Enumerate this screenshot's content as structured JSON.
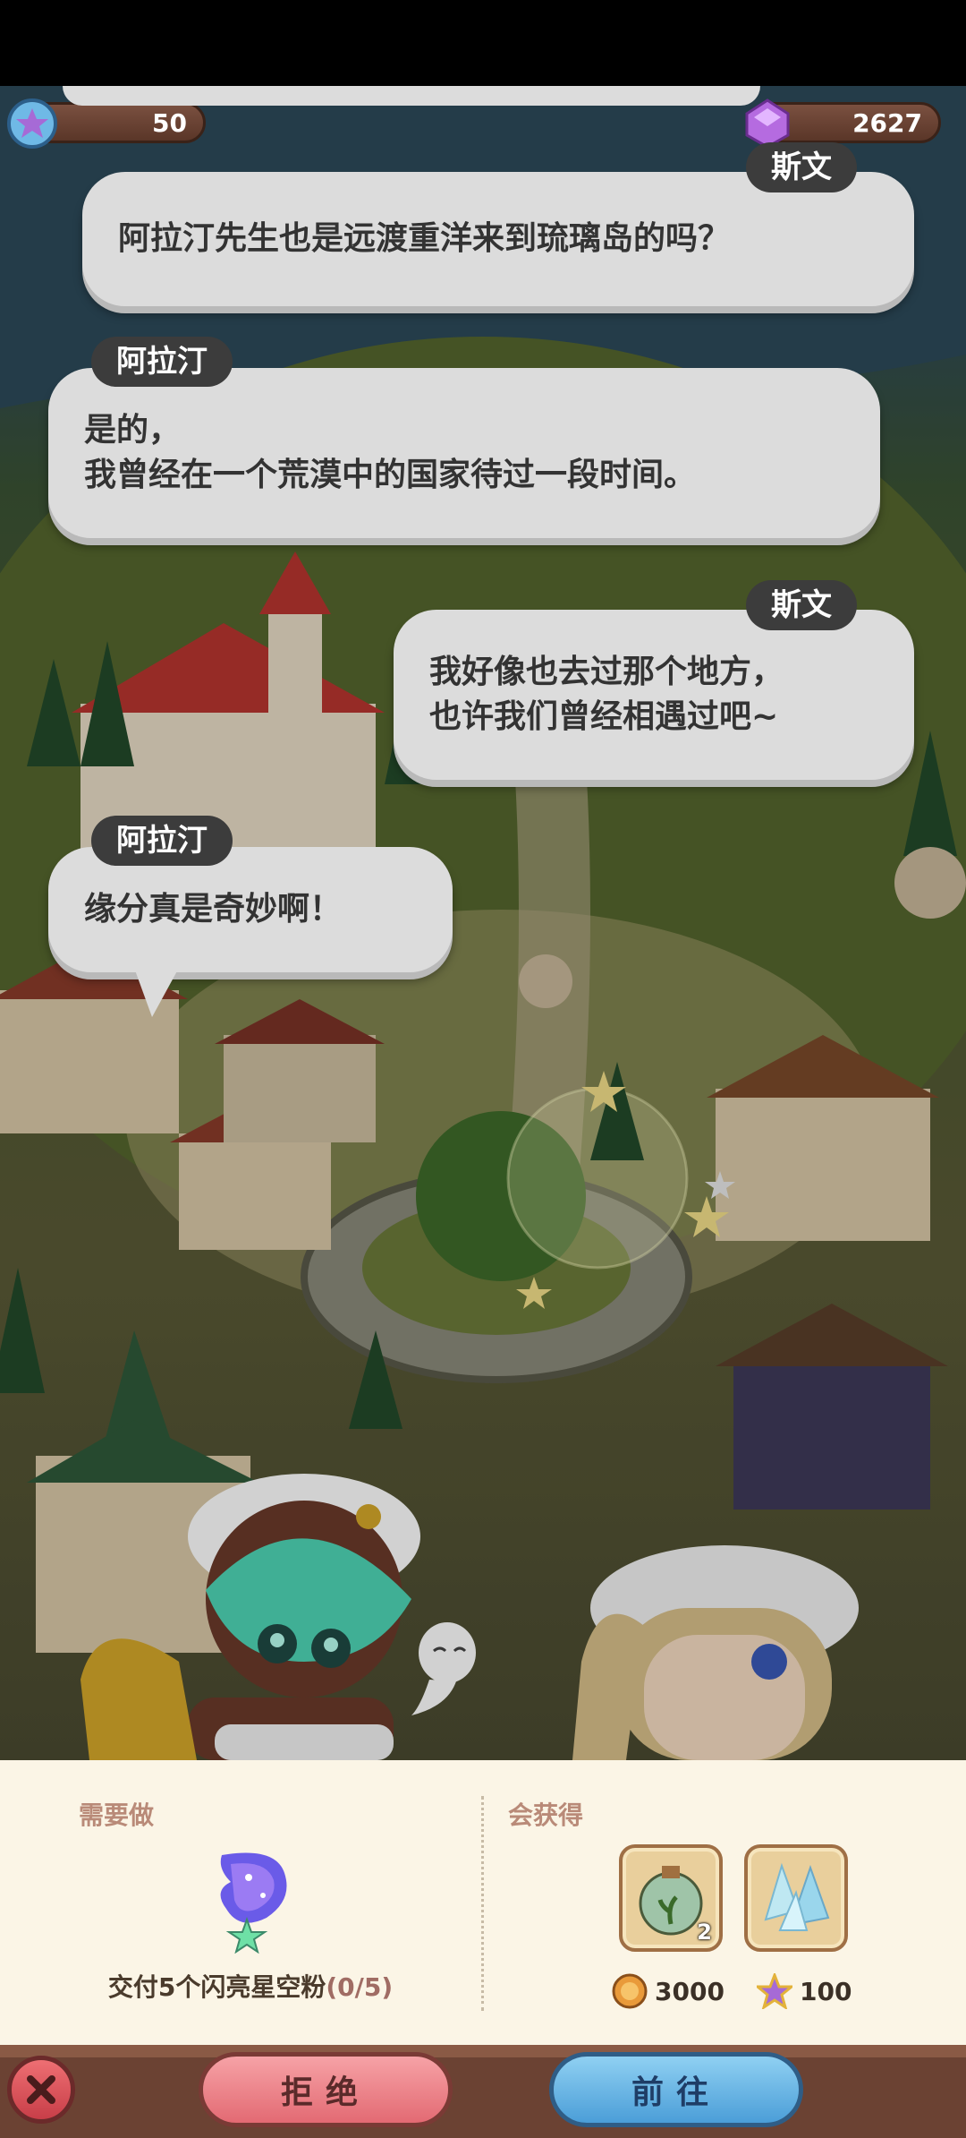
{
  "currency": {
    "stars": "50",
    "gems": "2627"
  },
  "dialogue": [
    {
      "speaker": "斯文",
      "lines": [
        "阿拉汀先生也是远渡重洋来到琉璃岛的吗？"
      ]
    },
    {
      "speaker": "阿拉汀",
      "lines": [
        "是的，",
        "我曾经在一个荒漠中的国家待过一段时间。"
      ]
    },
    {
      "speaker": "斯文",
      "lines": [
        "我好像也去过那个地方，",
        "也许我们曾经相遇过吧~"
      ]
    },
    {
      "speaker": "阿拉汀",
      "lines": [
        "缘分真是奇妙啊！"
      ]
    }
  ],
  "quest": {
    "todo_title": "需要做",
    "task_label": "交付5个闪亮星空粉",
    "task_progress": "(0/5)",
    "reward_title": "会获得",
    "rewards": [
      {
        "icon": "plant-bottle-icon",
        "count": "2"
      },
      {
        "icon": "crystal-shards-icon",
        "count": ""
      }
    ],
    "coin_reward": "3000",
    "star_reward": "100"
  },
  "buttons": {
    "refuse": "拒绝",
    "go": "前往"
  },
  "colors": {
    "bubble": "#dcdcdc",
    "nametag": "#3c3c3c",
    "refuse_button": "#e36a73",
    "go_button": "#4b9ed8",
    "panel": "#fbf5e6"
  }
}
